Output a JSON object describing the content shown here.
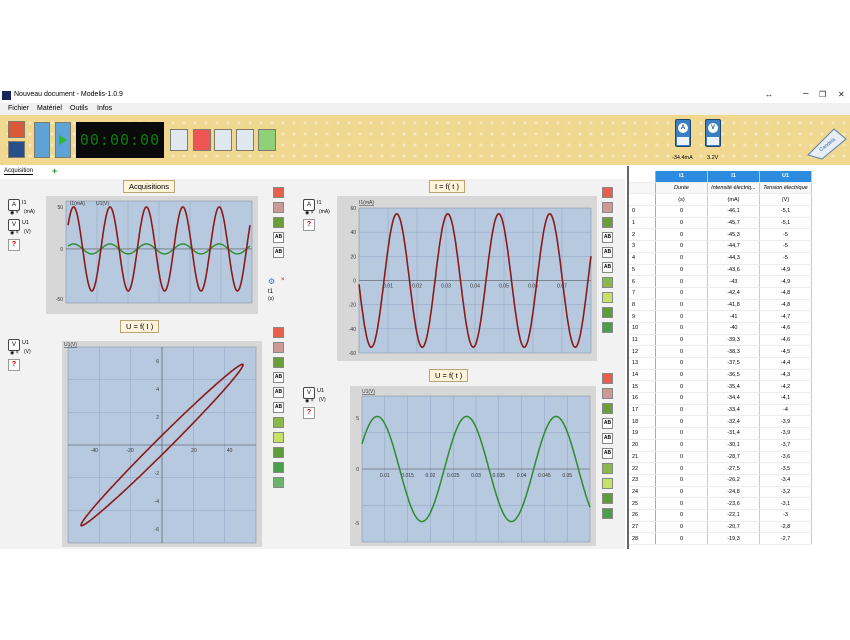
{
  "window": {
    "title": "Nouveau document - Modelis-1.0.9",
    "restore_icon": "↔",
    "maximize_icon": "❐",
    "close_icon": "✕"
  },
  "menu": [
    "Fichier",
    "Matériel",
    "Outils",
    "Infos"
  ],
  "toolbar": {
    "timer": "00:00:00"
  },
  "sensors": [
    {
      "letter": "A",
      "value": "-34.4mA"
    },
    {
      "letter": "V",
      "value": "3.2V"
    }
  ],
  "tabs": {
    "active": "Acquisition",
    "add": "+"
  },
  "panels": {
    "acq": {
      "title": "Acquisitions",
      "y_series": [
        "I1(mA)",
        "U1(V)"
      ],
      "x_series": "t1",
      "x_unit": "(s)",
      "yticks": [
        "50",
        "0",
        "-50"
      ],
      "close": "×"
    },
    "i_t": {
      "title": "I = f( t )",
      "ylabel": "I1(mA)",
      "yticks": [
        "60",
        "40",
        "20",
        "0",
        "-20",
        "-40",
        "-60"
      ],
      "xticks": [
        "0.01",
        "0.02",
        "0.03",
        "0.04",
        "0.05",
        "0.06",
        "0.07"
      ]
    },
    "u_i": {
      "title": "U = f( I )",
      "ylabel": "U1(V)",
      "yticks": [
        "6",
        "4",
        "2",
        "-2",
        "-4",
        "-6"
      ],
      "xticks": [
        "-40",
        "-20",
        "20",
        "40"
      ]
    },
    "u_t": {
      "title": "U = f( t )",
      "ylabel": "U1(V)",
      "yticks": [
        "5",
        "0",
        "-5"
      ],
      "xticks": [
        "0.01",
        "0.015",
        "0.02",
        "0.025",
        "0.03",
        "0.035",
        "0.04",
        "0.045",
        "0.05"
      ]
    }
  },
  "legend": {
    "i1": {
      "name": "I1",
      "unit": "(mA)"
    },
    "u1": {
      "name": "U1",
      "unit": "(V)"
    },
    "help": "?"
  },
  "table": {
    "columns": [
      {
        "name": "t1",
        "desc": "Durée",
        "unit": "(s)"
      },
      {
        "name": "I1",
        "desc": "Intensité électriq...",
        "unit": "(mA)"
      },
      {
        "name": "U1",
        "desc": "Tension électrique",
        "unit": "(V)"
      }
    ],
    "rows": [
      [
        "0",
        "0",
        "-46,1",
        "-5,1"
      ],
      [
        "1",
        "0",
        "-45,7",
        "-5,1"
      ],
      [
        "2",
        "0",
        "-45,3",
        "-5"
      ],
      [
        "3",
        "0",
        "-44,7",
        "-5"
      ],
      [
        "4",
        "0",
        "-44,3",
        "-5"
      ],
      [
        "5",
        "0",
        "-43,6",
        "-4,9"
      ],
      [
        "6",
        "0",
        "-43",
        "-4,9"
      ],
      [
        "7",
        "0",
        "-42,4",
        "-4,8"
      ],
      [
        "8",
        "0",
        "-41,8",
        "-4,8"
      ],
      [
        "9",
        "0",
        "-41",
        "-4,7"
      ],
      [
        "10",
        "0",
        "-40",
        "-4,6"
      ],
      [
        "11",
        "0",
        "-39,3",
        "-4,6"
      ],
      [
        "12",
        "0",
        "-38,3",
        "-4,5"
      ],
      [
        "13",
        "0",
        "-37,5",
        "-4,4"
      ],
      [
        "14",
        "0",
        "-36,5",
        "-4,3"
      ],
      [
        "15",
        "0",
        "-35,4",
        "-4,2"
      ],
      [
        "16",
        "0",
        "-34,4",
        "-4,1"
      ],
      [
        "17",
        "0",
        "-33,4",
        "-4"
      ],
      [
        "18",
        "0",
        "-32,4",
        "-3,9"
      ],
      [
        "19",
        "0",
        "-31,4",
        "-3,9"
      ],
      [
        "20",
        "0",
        "-30,1",
        "-3,7"
      ],
      [
        "21",
        "0",
        "-28,7",
        "-3,6"
      ],
      [
        "22",
        "0",
        "-27,5",
        "-3,5"
      ],
      [
        "23",
        "0",
        "-26,2",
        "-3,4"
      ],
      [
        "24",
        "0",
        "-24,8",
        "-3,2"
      ],
      [
        "25",
        "0",
        "-23,6",
        "-3,1"
      ],
      [
        "26",
        "0",
        "-22,1",
        "-3"
      ],
      [
        "27",
        "0",
        "-20,7",
        "-2,8"
      ],
      [
        "28",
        "0",
        "-19,3",
        "-2,7"
      ]
    ]
  },
  "colors": {
    "current": "#8b1a1a",
    "voltage": "#2e8b2e",
    "plot_bg": "#b7c9df",
    "toolbar": "#f1d890",
    "header": "#2d8ce0"
  }
}
